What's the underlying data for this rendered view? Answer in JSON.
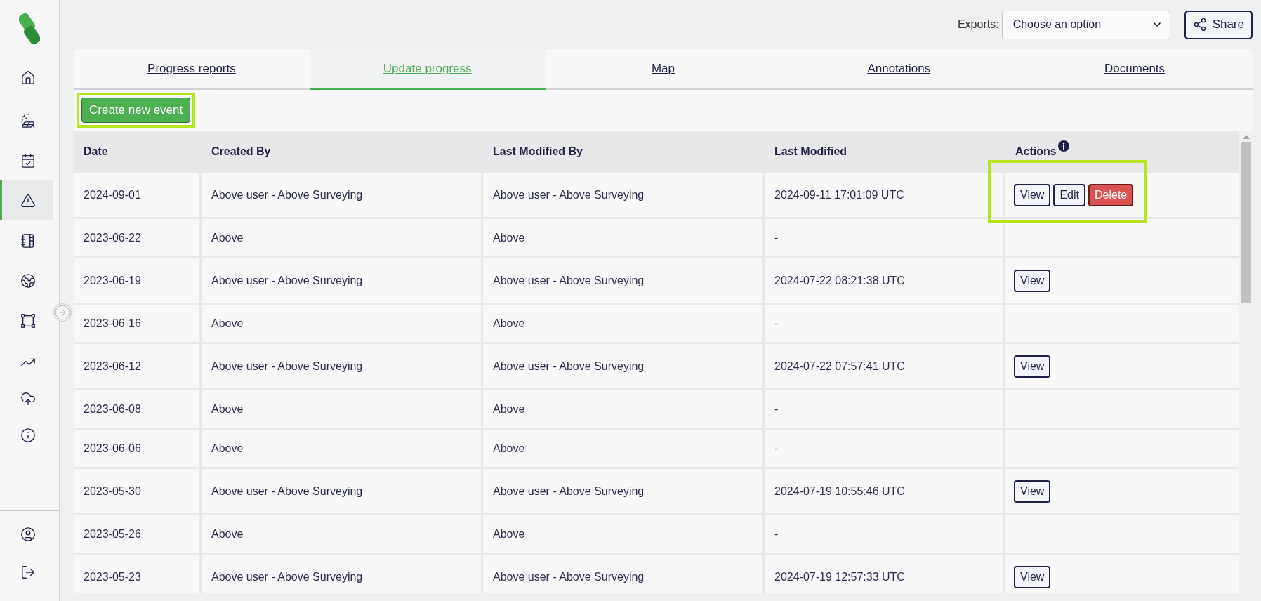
{
  "sidebar": {
    "sections": [
      {
        "boxed": false,
        "items": [
          {
            "selected": false
          }
        ]
      },
      {
        "boxed": true,
        "items": [
          {
            "selected": false
          },
          {
            "selected": false
          },
          {
            "selected": true
          },
          {
            "selected": false
          },
          {
            "selected": false
          },
          {
            "selected": false
          }
        ]
      },
      {
        "boxed": false,
        "items": [
          {
            "selected": false
          },
          {
            "selected": false
          },
          {
            "selected": false
          }
        ]
      }
    ],
    "bottom_items": [
      {
        "selected": false
      },
      {
        "selected": false
      }
    ]
  },
  "toolbar": {
    "exports_label": "Exports:",
    "exports_select": {
      "value": "Choose an option"
    },
    "share_button": "Share"
  },
  "tabs": [
    {
      "label": "Progress reports",
      "selected": false
    },
    {
      "label": "Update progress",
      "selected": true
    },
    {
      "label": "Map",
      "selected": false
    },
    {
      "label": "Annotations",
      "selected": false
    },
    {
      "label": "Documents",
      "selected": false
    }
  ],
  "create_button": {
    "label": "Create new event",
    "highlighted": true
  },
  "table": {
    "columns": [
      "Date",
      "Created By",
      "Last Modified By",
      "Last Modified",
      "Actions"
    ],
    "rows": [
      {
        "cells": [
          "2024-09-01",
          "Above user - Above Surveying",
          "Above user - Above Surveying",
          "2024-09-11 17:01:09 UTC"
        ],
        "highlighted": true,
        "actions": [
          {
            "label": "View",
            "kind": "outline"
          },
          {
            "label": "Edit",
            "kind": "outline"
          },
          {
            "label": "Delete",
            "kind": "danger"
          }
        ]
      },
      {
        "cells": [
          "2023-06-22",
          "Above",
          "Above",
          "-"
        ],
        "highlighted": false,
        "actions": []
      },
      {
        "cells": [
          "2023-06-19",
          "Above user - Above Surveying",
          "Above user - Above Surveying",
          "2024-07-22 08:21:38 UTC"
        ],
        "highlighted": false,
        "actions": [
          {
            "label": "View",
            "kind": "outline"
          }
        ]
      },
      {
        "cells": [
          "2023-06-16",
          "Above",
          "Above",
          "-"
        ],
        "highlighted": false,
        "actions": []
      },
      {
        "cells": [
          "2023-06-12",
          "Above user - Above Surveying",
          "Above user - Above Surveying",
          "2024-07-22 07:57:41 UTC"
        ],
        "highlighted": false,
        "actions": [
          {
            "label": "View",
            "kind": "outline"
          }
        ]
      },
      {
        "cells": [
          "2023-06-08",
          "Above",
          "Above",
          "-"
        ],
        "highlighted": false,
        "actions": []
      },
      {
        "cells": [
          "2023-06-06",
          "Above",
          "Above",
          "-"
        ],
        "highlighted": false,
        "actions": []
      },
      {
        "cells": [
          "2023-05-30",
          "Above user - Above Surveying",
          "Above user - Above Surveying",
          "2024-07-19 10:55:46 UTC"
        ],
        "highlighted": false,
        "actions": [
          {
            "label": "View",
            "kind": "outline"
          }
        ]
      },
      {
        "cells": [
          "2023-05-26",
          "Above",
          "Above",
          "-"
        ],
        "highlighted": false,
        "actions": []
      },
      {
        "cells": [
          "2023-05-23",
          "Above user - Above Surveying",
          "Above user - Above Surveying",
          "2024-07-19 12:57:33 UTC"
        ],
        "highlighted": false,
        "actions": [
          {
            "label": "View",
            "kind": "outline"
          }
        ]
      }
    ]
  }
}
